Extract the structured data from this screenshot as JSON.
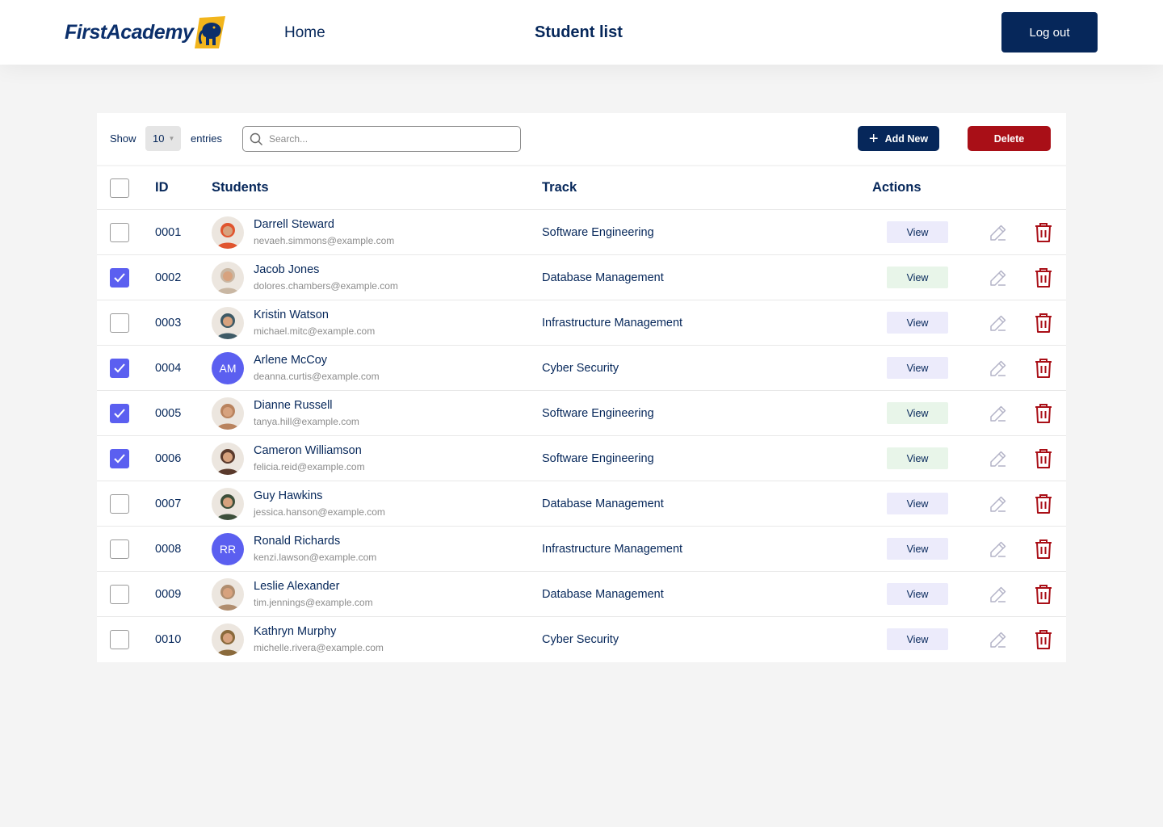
{
  "header": {
    "logo_text": "FirstAcademy",
    "nav_home": "Home",
    "page_title": "Student list",
    "logout_label": "Log out"
  },
  "toolbar": {
    "show_label": "Show",
    "entries_value": "10",
    "entries_label": "entries",
    "search_placeholder": "Search...",
    "add_new_label": "Add New",
    "delete_label": "Delete"
  },
  "table": {
    "columns": {
      "id": "ID",
      "students": "Students",
      "track": "Track",
      "actions": "Actions"
    },
    "rows": [
      {
        "id": "0001",
        "name": "Darrell Steward",
        "email": "nevaeh.simmons@example.com",
        "track": "Software Engineering",
        "checked": false,
        "view_label": "View",
        "view_style": "blue",
        "avatar": "photo",
        "avatar_color": "#e0552f",
        "avatar_initials": ""
      },
      {
        "id": "0002",
        "name": "Jacob Jones",
        "email": "dolores.chambers@example.com",
        "track": "Database Management",
        "checked": true,
        "view_label": "View",
        "view_style": "green",
        "avatar": "photo",
        "avatar_color": "#c9b7a3",
        "avatar_initials": ""
      },
      {
        "id": "0003",
        "name": "Kristin Watson",
        "email": "michael.mitc@example.com",
        "track": "Infrastructure Management",
        "checked": false,
        "view_label": "View",
        "view_style": "blue",
        "avatar": "photo",
        "avatar_color": "#3e5a66",
        "avatar_initials": ""
      },
      {
        "id": "0004",
        "name": "Arlene McCoy",
        "email": "deanna.curtis@example.com",
        "track": "Cyber Security",
        "checked": true,
        "view_label": "View",
        "view_style": "blue",
        "avatar": "initials",
        "avatar_color": "#5b5ff0",
        "avatar_initials": "AM"
      },
      {
        "id": "0005",
        "name": "Dianne Russell",
        "email": "tanya.hill@example.com",
        "track": "Software Engineering",
        "checked": true,
        "view_label": "View",
        "view_style": "green",
        "avatar": "photo",
        "avatar_color": "#b9835e",
        "avatar_initials": ""
      },
      {
        "id": "0006",
        "name": "Cameron Williamson",
        "email": "felicia.reid@example.com",
        "track": "Software Engineering",
        "checked": true,
        "view_label": "View",
        "view_style": "green",
        "avatar": "photo",
        "avatar_color": "#5a3a2c",
        "avatar_initials": ""
      },
      {
        "id": "0007",
        "name": "Guy Hawkins",
        "email": "jessica.hanson@example.com",
        "track": "Database Management",
        "checked": false,
        "view_label": "View",
        "view_style": "blue",
        "avatar": "photo",
        "avatar_color": "#3d4f3a",
        "avatar_initials": ""
      },
      {
        "id": "0008",
        "name": "Ronald Richards",
        "email": "kenzi.lawson@example.com",
        "track": "Infrastructure Management",
        "checked": false,
        "view_label": "View",
        "view_style": "blue",
        "avatar": "initials",
        "avatar_color": "#5b5ff0",
        "avatar_initials": "RR"
      },
      {
        "id": "0009",
        "name": "Leslie Alexander",
        "email": "tim.jennings@example.com",
        "track": "Database Management",
        "checked": false,
        "view_label": "View",
        "view_style": "blue",
        "avatar": "photo",
        "avatar_color": "#b08d6e",
        "avatar_initials": ""
      },
      {
        "id": "0010",
        "name": "Kathryn Murphy",
        "email": "michelle.rivera@example.com",
        "track": "Cyber Security",
        "checked": false,
        "view_label": "View",
        "view_style": "blue",
        "avatar": "photo",
        "avatar_color": "#8a6a3c",
        "avatar_initials": ""
      }
    ]
  },
  "colors": {
    "brand_navy": "#06275a",
    "danger_red": "#a90f17",
    "checkbox_purple": "#5b5ff0",
    "view_blue_bg": "#ecebfb",
    "view_green_bg": "#e8f5e9"
  },
  "icons": [
    "elephant-logo-icon",
    "search-icon",
    "plus-icon",
    "chevron-down-icon",
    "checkmark-icon",
    "pencil-edit-icon",
    "trash-icon"
  ]
}
